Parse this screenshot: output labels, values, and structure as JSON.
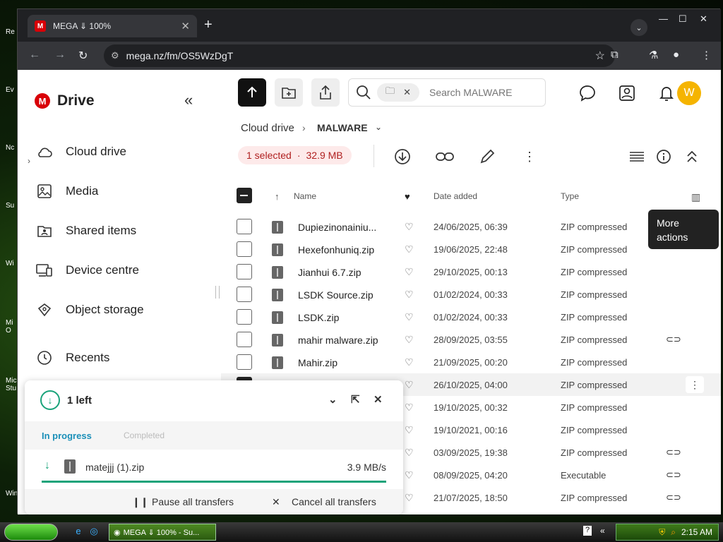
{
  "desktop": {
    "labels": [
      "Re",
      "Ev",
      "Nc",
      "Su",
      "Wi",
      "Mi O",
      "Micr Stu",
      "Wind"
    ]
  },
  "browser": {
    "tab_title": "MEGA ⇓ 100%",
    "tab_favicon": "M",
    "url": "mega.nz/fm/OS5WzDgT",
    "window_controls": [
      "minimize-icon",
      "maximize-icon",
      "close-icon"
    ]
  },
  "sidebar": {
    "brand": "Drive",
    "brand_letter": "M",
    "items": [
      {
        "label": "Cloud drive",
        "icon": "cloud-icon"
      },
      {
        "label": "Media",
        "icon": "image-icon"
      },
      {
        "label": "Shared items",
        "icon": "shared-folder-icon"
      },
      {
        "label": "Device centre",
        "icon": "device-icon"
      },
      {
        "label": "Object storage",
        "icon": "object-storage-icon"
      },
      {
        "label": "Recents",
        "icon": "clock-icon"
      }
    ]
  },
  "toolbar": {
    "search_placeholder": "Search MALWARE",
    "avatar_letter": "W"
  },
  "breadcrumb": {
    "root": "Cloud drive",
    "current": "MALWARE"
  },
  "selection": {
    "count_label": "1 selected",
    "separator": "·",
    "size": "32.9 MB"
  },
  "table": {
    "headers": {
      "name": "Name",
      "date": "Date added",
      "type": "Type"
    },
    "rows": [
      {
        "name": "Dupiezinonainiu...",
        "date": "24/06/2025, 06:39",
        "type": "ZIP compressed",
        "link": false
      },
      {
        "name": "Hexefonhuniq.zip",
        "date": "19/06/2025, 22:48",
        "type": "ZIP compressed",
        "link": false
      },
      {
        "name": "Jianhui 6.7.zip",
        "date": "29/10/2025, 00:13",
        "type": "ZIP compressed",
        "link": false
      },
      {
        "name": "LSDK Source.zip",
        "date": "01/02/2024, 00:33",
        "type": "ZIP compressed",
        "link": false
      },
      {
        "name": "LSDK.zip",
        "date": "01/02/2024, 00:33",
        "type": "ZIP compressed",
        "link": false
      },
      {
        "name": "mahir malware.zip",
        "date": "28/09/2025, 03:55",
        "type": "ZIP compressed",
        "link": true
      },
      {
        "name": "Mahir.zip",
        "date": "21/09/2025, 00:20",
        "type": "ZIP compressed",
        "link": false
      },
      {
        "name": "",
        "date": "26/10/2025, 04:00",
        "type": "ZIP compressed",
        "link": false,
        "selected": true
      },
      {
        "name": "",
        "date": "19/10/2025, 00:32",
        "type": "ZIP compressed",
        "link": false
      },
      {
        "name": "",
        "date": "19/10/2021, 00:16",
        "type": "ZIP compressed",
        "link": false
      },
      {
        "name": "",
        "date": "03/09/2025, 19:38",
        "type": "ZIP compressed",
        "link": true
      },
      {
        "name": "",
        "date": "08/09/2025, 04:20",
        "type": "Executable",
        "link": true
      },
      {
        "name": "",
        "date": "21/07/2025, 18:50",
        "type": "ZIP compressed",
        "link": true
      }
    ]
  },
  "tooltip": {
    "text": "More actions"
  },
  "transfers": {
    "title": "1 left",
    "tab_in_progress": "In progress",
    "tab_completed": "Completed",
    "file_name": "matejjj (1).zip",
    "speed": "3.9 MB/s",
    "progress": 1.0,
    "pause_label": "Pause all transfers",
    "cancel_label": "Cancel all transfers"
  },
  "taskbar": {
    "task_label": "MEGA ⇓ 100% - Su...",
    "time": "2:15 AM"
  },
  "colors": {
    "brand_red": "#d90007",
    "accent_green": "#1aa37a",
    "avatar": "#f5b400"
  }
}
